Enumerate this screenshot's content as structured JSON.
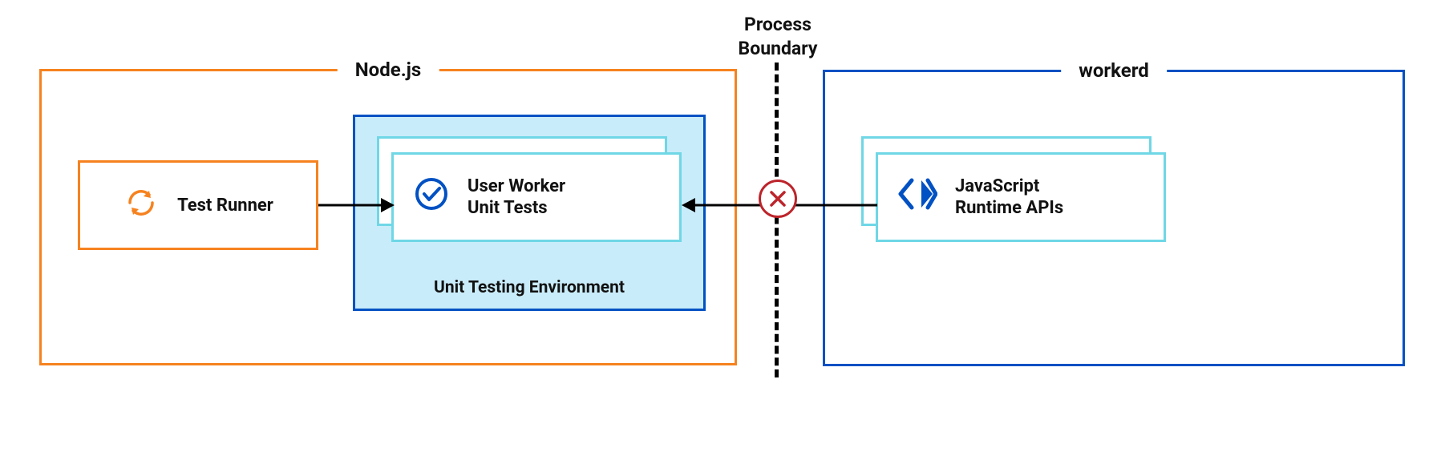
{
  "boundary": {
    "line1": "Process",
    "line2": "Boundary"
  },
  "nodejs": {
    "label": "Node.js",
    "test_runner": {
      "label": "Test Runner",
      "icon": "refresh-icon"
    },
    "env": {
      "label": "Unit Testing Environment",
      "unit_tests": {
        "line1": "User Worker",
        "line2": "Unit Tests",
        "icon": "check-circle-icon"
      }
    }
  },
  "workerd": {
    "label": "workerd",
    "runtime": {
      "line1": "JavaScript",
      "line2": "Runtime APIs",
      "icon": "chevrons-icon"
    }
  },
  "colors": {
    "orange": "#f6821f",
    "blue": "#0051c3",
    "cyan": "#a7e5f2",
    "red": "#bd242b"
  },
  "chart_data": {
    "type": "diagram",
    "title": "Worker unit testing architecture across process boundary",
    "nodes": [
      {
        "id": "nodejs",
        "label": "Node.js",
        "kind": "container",
        "color": "#f6821f"
      },
      {
        "id": "test_runner",
        "label": "Test Runner",
        "kind": "process",
        "parent": "nodejs",
        "icon": "refresh"
      },
      {
        "id": "unit_env",
        "label": "Unit Testing Environment",
        "kind": "container",
        "parent": "nodejs",
        "color": "#0051c3",
        "fill": "#c9ecfa"
      },
      {
        "id": "unit_tests",
        "label": "User Worker Unit Tests",
        "kind": "stack",
        "parent": "unit_env",
        "icon": "check-circle"
      },
      {
        "id": "boundary",
        "label": "Process Boundary",
        "kind": "divider",
        "style": "dashed"
      },
      {
        "id": "workerd",
        "label": "workerd",
        "kind": "container",
        "color": "#0051c3"
      },
      {
        "id": "runtime_apis",
        "label": "JavaScript Runtime APIs",
        "kind": "stack",
        "parent": "workerd",
        "icon": "chevrons"
      }
    ],
    "edges": [
      {
        "from": "test_runner",
        "to": "unit_tests",
        "direction": "right",
        "status": "ok"
      },
      {
        "from": "runtime_apis",
        "to": "unit_tests",
        "direction": "left",
        "status": "blocked",
        "blocked_at": "boundary"
      }
    ]
  }
}
